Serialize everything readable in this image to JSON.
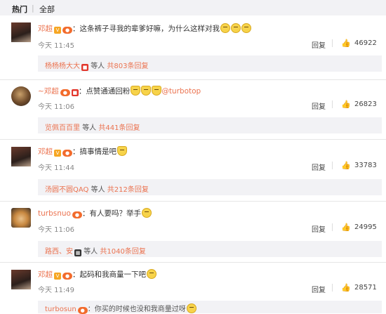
{
  "tabs": {
    "hot": "热门",
    "all": "全部"
  },
  "comments": [
    {
      "user": "邓超",
      "text": "这条裤子寻我的辈爹好嘛，为什么这样对我",
      "time": "今天 11:45",
      "reply_label": "回复",
      "likes": "46922",
      "sub": {
        "name": "杨杨杨大大",
        "wait": "等人",
        "count": "共803条回复"
      }
    },
    {
      "user": "~邓超",
      "text": "点赞通通回粉",
      "mention": "@turbotop",
      "time": "今天 11:06",
      "reply_label": "回复",
      "likes": "26823",
      "sub": {
        "name": "览佩百百里",
        "wait": "等人",
        "count": "共441条回复"
      }
    },
    {
      "user": "邓超",
      "text": "搞事情是吧",
      "time": "今天 11:44",
      "reply_label": "回复",
      "likes": "33783",
      "sub": {
        "name": "汤圆不圆QAQ",
        "wait": "等人",
        "count": "共212条回复"
      }
    },
    {
      "user": "turbsnuo",
      "text": "有人要吗？举手",
      "time": "今天 11:06",
      "reply_label": "回复",
      "likes": "24995",
      "sub": {
        "name": "路西、安",
        "wait": "等人",
        "count": "共1040条回复"
      }
    },
    {
      "user": "邓超",
      "text": "起码和我商量一下吧",
      "time": "今天 11:49",
      "reply_label": "回复",
      "likes": "28571"
    },
    {
      "user": "turbosun",
      "text": "你买的时候也没和我商量过呀"
    }
  ],
  "colors": {
    "accent": "#eb7350",
    "panel": "#f2f2f5"
  }
}
